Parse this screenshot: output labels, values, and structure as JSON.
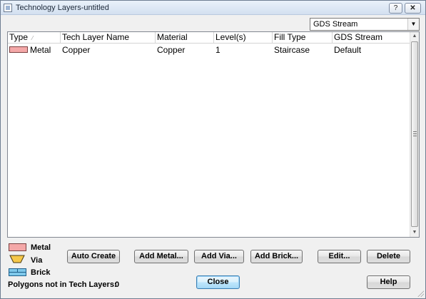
{
  "window": {
    "title": "Technology Layers-untitled",
    "help_btn": "?",
    "close_btn": "✕"
  },
  "view_selector": {
    "selected": "GDS Stream"
  },
  "table": {
    "columns": [
      "Type",
      "Tech Layer Name",
      "Material",
      "Level(s)",
      "Fill Type",
      "GDS Stream"
    ],
    "sort_column": "Type",
    "rows": [
      {
        "type": "Metal",
        "type_swatch_color": "#f4a8a8",
        "tech_layer_name": "Copper",
        "material": "Copper",
        "levels": "1",
        "fill_type": "Staircase",
        "gds_stream": "Default"
      }
    ]
  },
  "legend": {
    "metal": "Metal",
    "via": "Via",
    "brick": "Brick",
    "metal_color": "#f4a8a8",
    "via_color": "#f6c84a",
    "brick_color": "#7ec8ea"
  },
  "buttons": {
    "auto_create": "Auto Create",
    "add_metal": "Add Metal...",
    "add_via": "Add Via...",
    "add_brick": "Add Brick...",
    "edit": "Edit...",
    "delete": "Delete",
    "close": "Close",
    "help": "Help"
  },
  "status": {
    "label": "Polygons not in Tech Layers:",
    "count": "0"
  }
}
